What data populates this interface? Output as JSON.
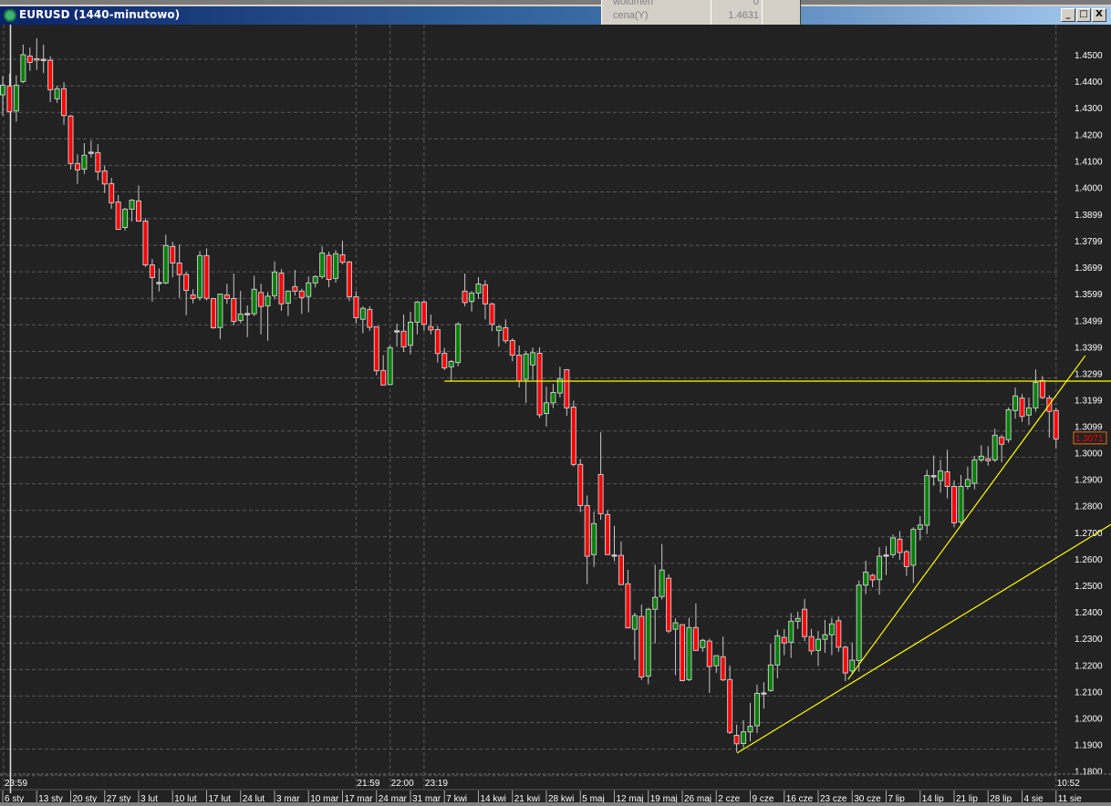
{
  "window": {
    "title": "EURUSD (1440-minutowo)",
    "buttons": {
      "minimize": "_",
      "maximize": "□",
      "close": "X"
    }
  },
  "tooltip": {
    "rows": [
      {
        "label": "wolumen",
        "value": "0"
      },
      {
        "label": "cena(Y)",
        "value": "1.4631"
      }
    ]
  },
  "colors": {
    "background": "#222222",
    "grid": "#5a5a5a",
    "up": "#008000",
    "down": "#ff0000",
    "outline": "#c8c8c8",
    "lines": "#ffff00",
    "last_price": "#ff0000",
    "last_price_border": "#e07020"
  },
  "chart_data": {
    "type": "candlestick",
    "symbol": "EURUSD",
    "ylim": [
      1.18,
      1.46
    ],
    "grid": true,
    "y_ticks": [
      "1.4500",
      "1.4400",
      "1.4300",
      "1.4200",
      "1.4100",
      "1.4000",
      "1.3899",
      "1.3799",
      "1.3699",
      "1.3599",
      "1.3499",
      "1.3399",
      "1.3299",
      "1.3199",
      "1.3099",
      "1.3000",
      "1.2900",
      "1.2800",
      "1.2700",
      "1.2600",
      "1.2500",
      "1.2400",
      "1.2300",
      "1.2200",
      "1.2100",
      "1.2000",
      "1.1900",
      "1.1800"
    ],
    "last_price": "1.3071",
    "x_date_labels": [
      "6 sty",
      "13 sty",
      "20 sty",
      "27 sty",
      "3 lut",
      "10 lut",
      "17 lut",
      "24 lut",
      "3 mar",
      "10 mar",
      "17 mar",
      "24 mar",
      "31 mar",
      "7 kwi",
      "14 kwi",
      "21 kwi",
      "28 kwi",
      "5 maj",
      "12 maj",
      "19 maj",
      "26 maj",
      "2 cze",
      "9 cze",
      "16 cze",
      "23 cze",
      "30 cze",
      "7 lip",
      "14 lip",
      "21 lip",
      "28 lip",
      "4 sie",
      "11 sie"
    ],
    "x_time_labels": [
      {
        "bar": 0,
        "label": "23:59"
      },
      {
        "bar": 52,
        "label": "21:59"
      },
      {
        "bar": 57,
        "label": "22:00"
      },
      {
        "bar": 62,
        "label": "23:19"
      },
      {
        "bar": 155,
        "label": "10:52"
      }
    ],
    "candles_ohlc": [
      [
        1.4366,
        1.4437,
        1.4288,
        1.4402
      ],
      [
        1.4399,
        1.4446,
        1.4303,
        1.4303
      ],
      [
        1.4305,
        1.4439,
        1.4265,
        1.4402
      ],
      [
        1.4416,
        1.4555,
        1.441,
        1.4517
      ],
      [
        1.4512,
        1.4544,
        1.4456,
        1.4488
      ],
      [
        1.4502,
        1.4579,
        1.446,
        1.4497
      ],
      [
        1.45,
        1.4555,
        1.4448,
        1.45
      ],
      [
        1.4496,
        1.4511,
        1.4339,
        1.4385
      ],
      [
        1.4351,
        1.44,
        1.4336,
        1.4389
      ],
      [
        1.4389,
        1.4414,
        1.4253,
        1.4288
      ],
      [
        1.4286,
        1.429,
        1.4085,
        1.4107
      ],
      [
        1.4107,
        1.4142,
        1.403,
        1.4083
      ],
      [
        1.4086,
        1.4184,
        1.4068,
        1.4138
      ],
      [
        1.415,
        1.4194,
        1.413,
        1.415
      ],
      [
        1.4148,
        1.418,
        1.4044,
        1.4076
      ],
      [
        1.4079,
        1.4099,
        1.3996,
        1.403
      ],
      [
        1.4031,
        1.4053,
        1.3936,
        1.3959
      ],
      [
        1.3962,
        1.3988,
        1.3859,
        1.3859
      ],
      [
        1.3866,
        1.394,
        1.3855,
        1.3935
      ],
      [
        1.3935,
        1.3973,
        1.3889,
        1.3969
      ],
      [
        1.3966,
        1.4025,
        1.389,
        1.389
      ],
      [
        1.389,
        1.3901,
        1.3717,
        1.3725
      ],
      [
        1.3725,
        1.3747,
        1.3587,
        1.3677
      ],
      [
        1.3659,
        1.3712,
        1.3625,
        1.3659
      ],
      [
        1.3657,
        1.3839,
        1.3652,
        1.3798
      ],
      [
        1.3794,
        1.3812,
        1.3678,
        1.3732
      ],
      [
        1.3732,
        1.3802,
        1.3601,
        1.3688
      ],
      [
        1.3689,
        1.3698,
        1.3535,
        1.3629
      ],
      [
        1.3612,
        1.3633,
        1.358,
        1.3598
      ],
      [
        1.3602,
        1.3777,
        1.3591,
        1.376
      ],
      [
        1.376,
        1.3787,
        1.3591,
        1.3599
      ],
      [
        1.3598,
        1.3598,
        1.3484,
        1.3488
      ],
      [
        1.3489,
        1.3615,
        1.3446,
        1.3615
      ],
      [
        1.3612,
        1.3654,
        1.3578,
        1.3598
      ],
      [
        1.3598,
        1.3692,
        1.3497,
        1.3512
      ],
      [
        1.3516,
        1.3627,
        1.3505,
        1.354
      ],
      [
        1.3542,
        1.3572,
        1.3453,
        1.3542
      ],
      [
        1.3541,
        1.3684,
        1.3532,
        1.3633
      ],
      [
        1.3621,
        1.3654,
        1.3463,
        1.3568
      ],
      [
        1.3571,
        1.3623,
        1.3439,
        1.3607
      ],
      [
        1.3609,
        1.3738,
        1.3595,
        1.3698
      ],
      [
        1.3694,
        1.3709,
        1.3552,
        1.3578
      ],
      [
        1.3581,
        1.3629,
        1.3532,
        1.3626
      ],
      [
        1.3643,
        1.3706,
        1.3609,
        1.3626
      ],
      [
        1.3626,
        1.3635,
        1.354,
        1.3602
      ],
      [
        1.3606,
        1.3681,
        1.3546,
        1.3657
      ],
      [
        1.3657,
        1.3686,
        1.364,
        1.3681
      ],
      [
        1.3681,
        1.3795,
        1.3672,
        1.377
      ],
      [
        1.3761,
        1.3775,
        1.3641,
        1.367
      ],
      [
        1.3674,
        1.3781,
        1.3658,
        1.3767
      ],
      [
        1.3763,
        1.3816,
        1.3727,
        1.3735
      ],
      [
        1.3736,
        1.374,
        1.3589,
        1.3605
      ],
      [
        1.3605,
        1.3626,
        1.3503,
        1.3526
      ],
      [
        1.352,
        1.3569,
        1.3467,
        1.3561
      ],
      [
        1.3557,
        1.3569,
        1.3477,
        1.349
      ],
      [
        1.3492,
        1.3492,
        1.3309,
        1.3326
      ],
      [
        1.3327,
        1.3385,
        1.3272,
        1.3272
      ],
      [
        1.3274,
        1.3422,
        1.3274,
        1.3413
      ],
      [
        1.3477,
        1.3503,
        1.3417,
        1.3477
      ],
      [
        1.3475,
        1.3538,
        1.3397,
        1.3416
      ],
      [
        1.3422,
        1.3548,
        1.3388,
        1.3509
      ],
      [
        1.3509,
        1.3589,
        1.3463,
        1.3585
      ],
      [
        1.3585,
        1.3591,
        1.3477,
        1.3501
      ],
      [
        1.3492,
        1.3538,
        1.3463,
        1.348
      ],
      [
        1.3481,
        1.3495,
        1.3357,
        1.3391
      ],
      [
        1.3392,
        1.3412,
        1.3328,
        1.3337
      ],
      [
        1.3341,
        1.3366,
        1.3286,
        1.3361
      ],
      [
        1.3357,
        1.3509,
        1.3343,
        1.3502
      ],
      [
        1.3626,
        1.3692,
        1.3569,
        1.3583
      ],
      [
        1.3587,
        1.3626,
        1.3549,
        1.3619
      ],
      [
        1.3619,
        1.3679,
        1.3597,
        1.3653
      ],
      [
        1.365,
        1.3667,
        1.352,
        1.3578
      ],
      [
        1.3578,
        1.3583,
        1.3475,
        1.3501
      ],
      [
        1.3478,
        1.3497,
        1.3417,
        1.3492
      ],
      [
        1.3488,
        1.352,
        1.3429,
        1.3439
      ],
      [
        1.344,
        1.3448,
        1.3362,
        1.3385
      ],
      [
        1.3385,
        1.3421,
        1.3263,
        1.3287
      ],
      [
        1.3294,
        1.34,
        1.3205,
        1.3389
      ],
      [
        1.3348,
        1.3414,
        1.3291,
        1.3394
      ],
      [
        1.3392,
        1.3414,
        1.3148,
        1.316
      ],
      [
        1.3165,
        1.3266,
        1.3116,
        1.3205
      ],
      [
        1.3205,
        1.3276,
        1.3185,
        1.3244
      ],
      [
        1.3242,
        1.3341,
        1.3225,
        1.3295
      ],
      [
        1.333,
        1.333,
        1.3156,
        1.3186
      ],
      [
        1.3189,
        1.3213,
        1.2965,
        1.2973
      ],
      [
        1.2973,
        1.2994,
        1.2793,
        1.2818
      ],
      [
        1.2818,
        1.2856,
        1.2522,
        1.2627
      ],
      [
        1.2633,
        1.2795,
        1.2587,
        1.275
      ],
      [
        1.2935,
        1.3094,
        1.2764,
        1.2787
      ],
      [
        1.2784,
        1.2801,
        1.2633,
        1.2633
      ],
      [
        1.2632,
        1.2741,
        1.2608,
        1.2632
      ],
      [
        1.263,
        1.2683,
        1.252,
        1.252
      ],
      [
        1.2523,
        1.2576,
        1.2357,
        1.2357
      ],
      [
        1.2352,
        1.2414,
        1.2236,
        1.2403
      ],
      [
        1.24,
        1.2445,
        1.2161,
        1.2172
      ],
      [
        1.2175,
        1.2433,
        1.2144,
        1.2427
      ],
      [
        1.2427,
        1.2595,
        1.2299,
        1.2472
      ],
      [
        1.2475,
        1.2673,
        1.2464,
        1.2575
      ],
      [
        1.2544,
        1.2559,
        1.2337,
        1.2345
      ],
      [
        1.2352,
        1.2393,
        1.2179,
        1.2376
      ],
      [
        1.2369,
        1.2369,
        1.2156,
        1.2158
      ],
      [
        1.2162,
        1.2395,
        1.2156,
        1.2358
      ],
      [
        1.2358,
        1.2449,
        1.227,
        1.2272
      ],
      [
        1.2283,
        1.2316,
        1.2267,
        1.231
      ],
      [
        1.2307,
        1.2316,
        1.2112,
        1.2211
      ],
      [
        1.2214,
        1.2252,
        1.2187,
        1.2252
      ],
      [
        1.2248,
        1.2324,
        1.2156,
        1.2161
      ],
      [
        1.2162,
        1.2215,
        1.1957,
        1.1963
      ],
      [
        1.1952,
        1.1992,
        1.1889,
        1.192
      ],
      [
        1.1921,
        1.2009,
        1.1904,
        1.1965
      ],
      [
        1.1965,
        1.2074,
        1.1929,
        1.1986
      ],
      [
        1.1988,
        1.2143,
        1.196,
        1.211
      ],
      [
        1.2112,
        1.2152,
        1.2053,
        1.2112
      ],
      [
        1.2121,
        1.2298,
        1.2116,
        1.2217
      ],
      [
        1.2217,
        1.235,
        1.2167,
        1.2327
      ],
      [
        1.2321,
        1.2353,
        1.2254,
        1.23
      ],
      [
        1.2303,
        1.2412,
        1.2244,
        1.2382
      ],
      [
        1.2382,
        1.2418,
        1.2353,
        1.2392
      ],
      [
        1.2427,
        1.2466,
        1.2307,
        1.2324
      ],
      [
        1.2324,
        1.2353,
        1.2255,
        1.227
      ],
      [
        1.2272,
        1.2345,
        1.2213,
        1.2314
      ],
      [
        1.2314,
        1.2387,
        1.2263,
        1.2331
      ],
      [
        1.2331,
        1.2395,
        1.2254,
        1.2372
      ],
      [
        1.2384,
        1.2398,
        1.2267,
        1.2284
      ],
      [
        1.2284,
        1.229,
        1.2156,
        1.2187
      ],
      [
        1.2195,
        1.2301,
        1.2181,
        1.2235
      ],
      [
        1.2234,
        1.2535,
        1.2192,
        1.2518
      ],
      [
        1.2518,
        1.261,
        1.2484,
        1.2567
      ],
      [
        1.2555,
        1.2561,
        1.251,
        1.2538
      ],
      [
        1.2539,
        1.2661,
        1.2482,
        1.2627
      ],
      [
        1.2632,
        1.2665,
        1.2556,
        1.2632
      ],
      [
        1.2633,
        1.2709,
        1.2621,
        1.2696
      ],
      [
        1.2691,
        1.2722,
        1.2613,
        1.2641
      ],
      [
        1.2644,
        1.265,
        1.2553,
        1.2588
      ],
      [
        1.2593,
        1.2736,
        1.2526,
        1.2728
      ],
      [
        1.2729,
        1.2778,
        1.2687,
        1.2745
      ],
      [
        1.2744,
        1.2953,
        1.2711,
        1.2931
      ],
      [
        1.2931,
        1.3007,
        1.2893,
        1.2931
      ],
      [
        1.2912,
        1.299,
        1.2867,
        1.2948
      ],
      [
        1.2945,
        1.3028,
        1.2845,
        1.289
      ],
      [
        1.289,
        1.2913,
        1.2736,
        1.2753
      ],
      [
        1.2756,
        1.2933,
        1.2745,
        1.289
      ],
      [
        1.289,
        1.2965,
        1.2879,
        1.2916
      ],
      [
        1.2902,
        1.3005,
        1.2879,
        1.299
      ],
      [
        1.299,
        1.3045,
        1.2982,
        1.3004
      ],
      [
        1.2994,
        1.3042,
        1.2968,
        1.2987
      ],
      [
        1.299,
        1.3108,
        1.2982,
        1.3083
      ],
      [
        1.3076,
        1.3085,
        1.2982,
        1.3049
      ],
      [
        1.3066,
        1.3188,
        1.3054,
        1.3179
      ],
      [
        1.3176,
        1.3263,
        1.3145,
        1.3231
      ],
      [
        1.3223,
        1.3238,
        1.3133,
        1.3154
      ],
      [
        1.3159,
        1.3225,
        1.3122,
        1.3186
      ],
      [
        1.3186,
        1.3331,
        1.3171,
        1.3282
      ],
      [
        1.3289,
        1.3306,
        1.3219,
        1.3225
      ],
      [
        1.3223,
        1.3234,
        1.3074,
        1.3173
      ],
      [
        1.3176,
        1.3186,
        1.3034,
        1.3069
      ]
    ],
    "drawn_lines": [
      {
        "kind": "horizontal",
        "from_bar": 65,
        "price": 1.3287
      },
      {
        "kind": "trendline",
        "from": {
          "bar": 108.05,
          "price": 1.1885
        },
        "to": {
          "bar": 163.1,
          "price": 1.2747
        }
      },
      {
        "kind": "trendline",
        "from": {
          "bar": 124.4,
          "price": 1.2163
        },
        "to": {
          "bar": 159.3,
          "price": 1.3383
        }
      }
    ]
  }
}
